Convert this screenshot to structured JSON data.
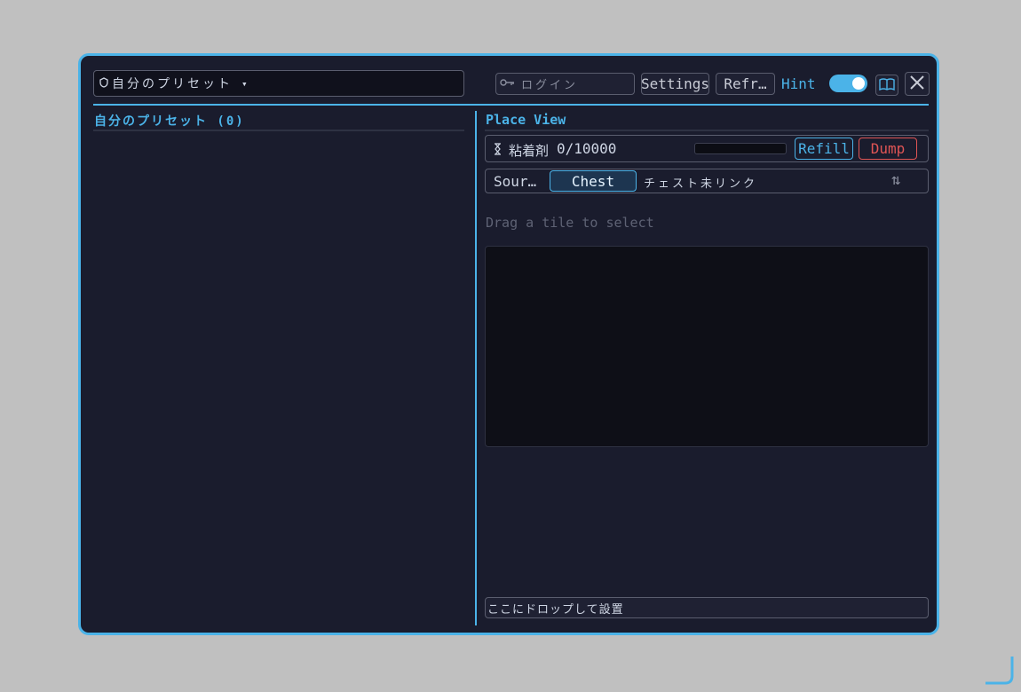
{
  "header": {
    "preset_select": {
      "value": "自分のプリセット",
      "icon": "shield-icon",
      "caret": "▾"
    },
    "login_field": {
      "placeholder": "ログイン",
      "icon": "key-icon"
    },
    "settings_label": "Settings",
    "refresh_label": "Refr…",
    "hint_label": "Hint",
    "hint_toggle_on": true,
    "book_icon": "book-icon",
    "close_icon": "close-icon"
  },
  "left_panel": {
    "title": "自分のプリセット (0)"
  },
  "right_panel": {
    "title": "Place View",
    "adhesive": {
      "icon": "hourglass-icon",
      "label": "粘着剤",
      "value": "0/10000",
      "progress": 0,
      "refill_label": "Refill",
      "dump_label": "Dump"
    },
    "source": {
      "label": "Sour…",
      "chest_label": "Chest",
      "status": "チェスト未リンク",
      "sort_icon": "sort-arrows-icon",
      "sort_glyph": "⇅"
    },
    "drag_hint": "Drag a tile to select",
    "drop_field": "ここにドロップして設置"
  },
  "colors": {
    "accent": "#4bb3e8",
    "danger": "#e05555",
    "background": "#1a1c2d"
  }
}
